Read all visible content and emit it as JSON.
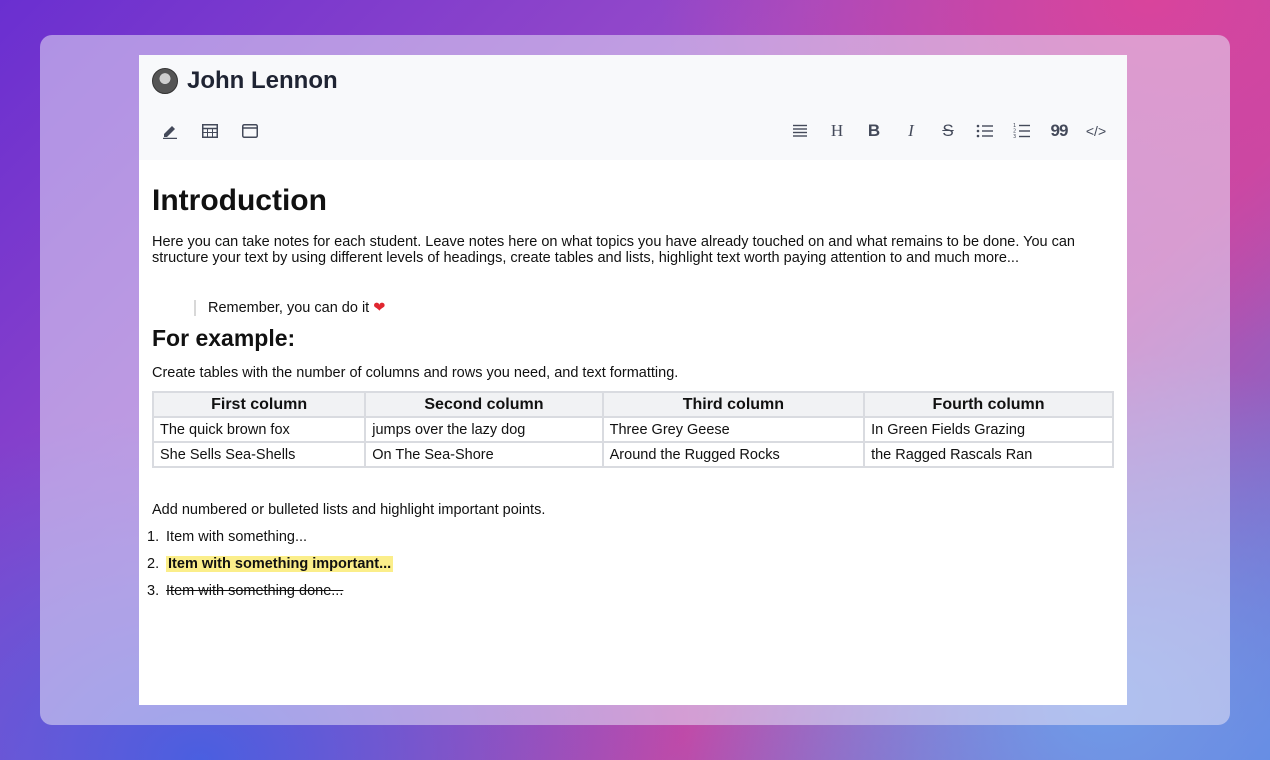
{
  "user": {
    "name": "John Lennon"
  },
  "toolbar": {
    "left": [
      {
        "icon": "highlighter-icon"
      },
      {
        "icon": "table-icon"
      },
      {
        "icon": "window-icon"
      }
    ],
    "right": [
      {
        "icon": "align-icon"
      },
      {
        "icon": "heading-icon",
        "label": "H"
      },
      {
        "icon": "bold-icon",
        "label": "B"
      },
      {
        "icon": "italic-icon",
        "label": "I"
      },
      {
        "icon": "strikethrough-icon",
        "label": "S"
      },
      {
        "icon": "bullet-list-icon"
      },
      {
        "icon": "numbered-list-icon"
      },
      {
        "icon": "quote-icon",
        "label": "99"
      },
      {
        "icon": "code-icon",
        "label": "</>"
      }
    ]
  },
  "content": {
    "heading": "Introduction",
    "intro": "Here you can take notes for each student. Leave notes here on what topics you have already touched on and what remains to be done. You can structure your text by using different levels of headings, create tables and lists, highlight text worth paying attention to and much more...",
    "quote": "Remember, you can do it",
    "quote_emoji": "❤",
    "subheading": "For example:",
    "table_intro": "Create tables with the number of columns and rows you need, and text formatting.",
    "table": {
      "headers": [
        "First column",
        "Second column",
        "Third column",
        "Fourth column"
      ],
      "rows": [
        [
          "The quick brown fox",
          "jumps over the lazy dog",
          "Three Grey Geese",
          "In Green Fields Grazing"
        ],
        [
          "She Sells Sea-Shells",
          "On The Sea-Shore",
          "Around the Rugged Rocks",
          "the Ragged Rascals Ran"
        ]
      ]
    },
    "list_intro": "Add numbered or bulleted lists and highlight important points.",
    "list": [
      {
        "num": "1.",
        "text": "Item with something..."
      },
      {
        "num": "2.",
        "text": "Item with something important..."
      },
      {
        "num": "3.",
        "text": "Item with something done..."
      }
    ]
  }
}
